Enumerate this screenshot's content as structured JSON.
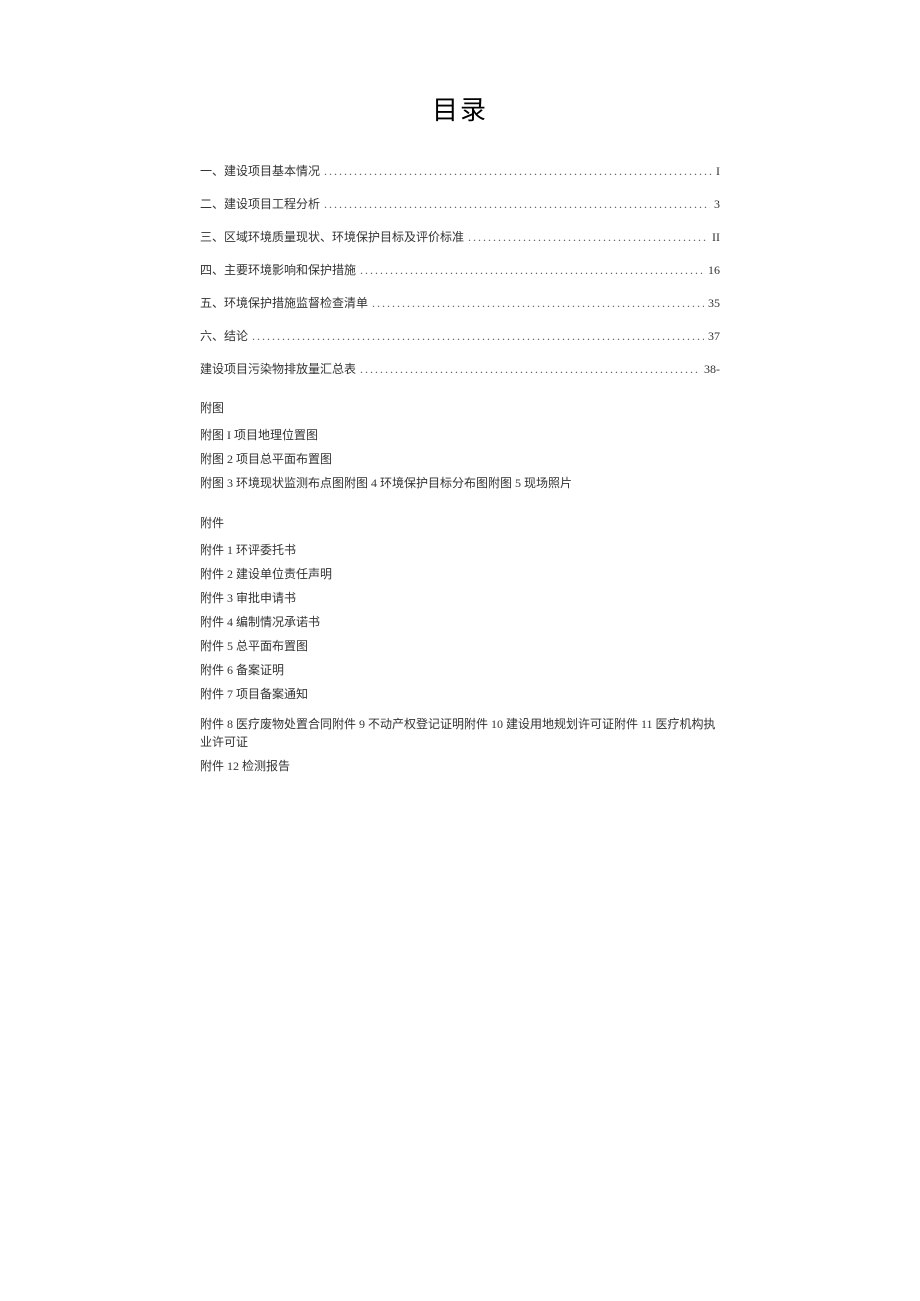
{
  "title": "目录",
  "toc": [
    {
      "label": "一、建设项目基本情况",
      "page": "I"
    },
    {
      "label": "二、建设项目工程分析",
      "page": "3"
    },
    {
      "label": "三、区域环境质量现状、环境保护目标及评价标准",
      "page": "II"
    },
    {
      "label": "四、主要环境影响和保护措施",
      "page": "16"
    },
    {
      "label": "五、环境保护措施监督检查清单",
      "page": "35"
    },
    {
      "label": "六、结论",
      "page": "37"
    },
    {
      "label": "建设项目污染物排放量汇总表",
      "page": "38-"
    }
  ],
  "fig_header": "附图",
  "figs": [
    "附图 I 项目地理位置图",
    "附图 2 项目总平面布置图",
    "附图 3 环境现状监测布点图附图 4 环境保护目标分布图附图 5 现场照片"
  ],
  "att_header": "附件",
  "atts": [
    "附件 1 环评委托书",
    "附件 2 建设单位责任声明",
    "附件 3 审批申请书",
    "附件 4 编制情况承诺书",
    "附件 5 总平面布置图",
    "附件 6 备案证明",
    "附件 7 项目备案通知",
    "附件 8 医疗废物处置合同附件 9 不动产权登记证明附件 10 建设用地规划许可证附件 11 医疗机构执业许可证",
    "附件 12 检测报告"
  ]
}
